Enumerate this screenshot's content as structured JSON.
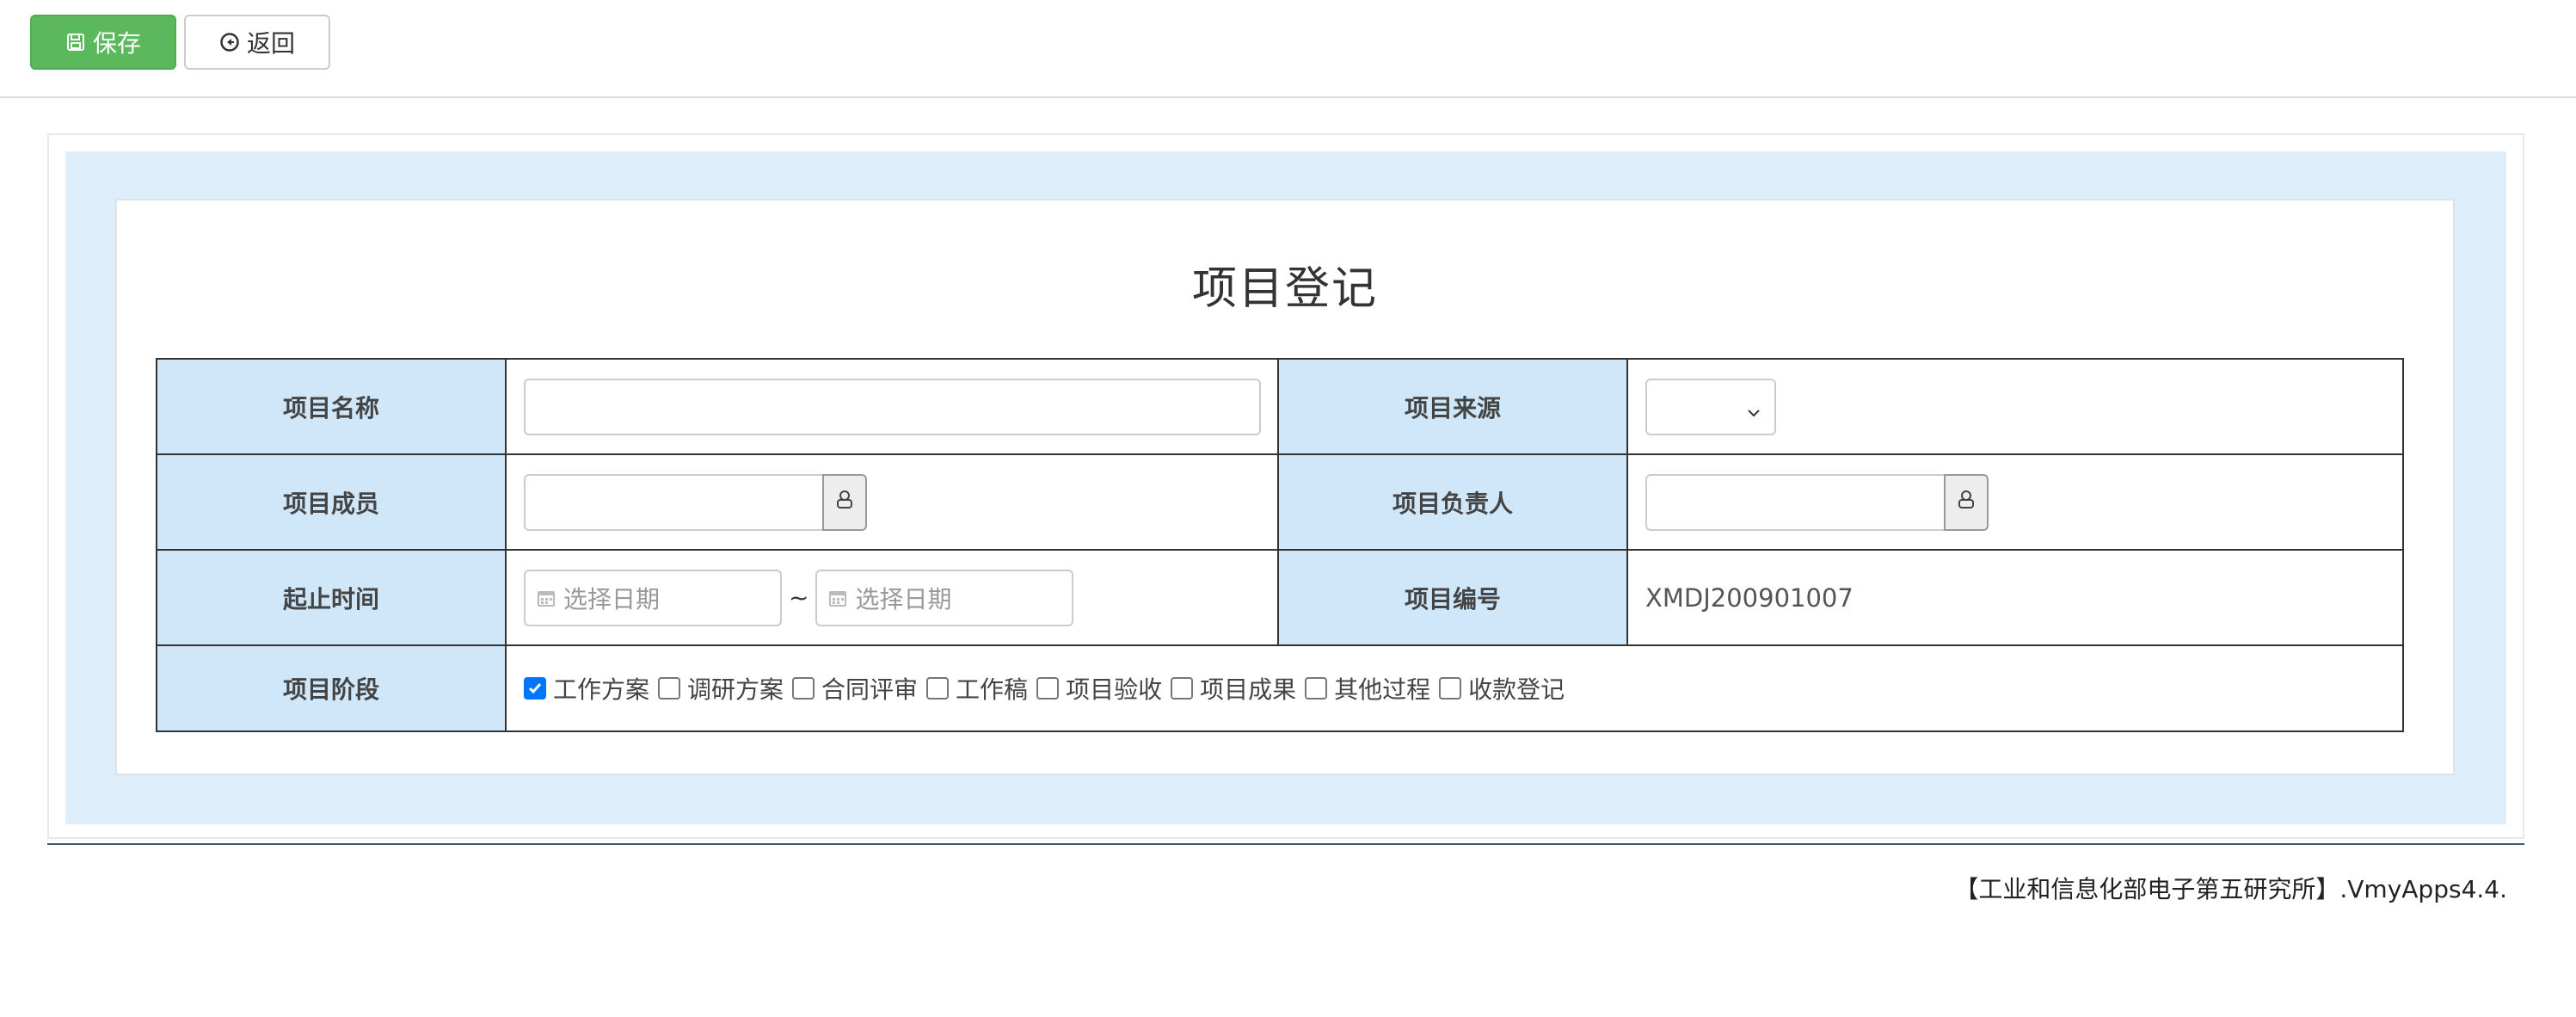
{
  "toolbar": {
    "save_label": "保存",
    "back_label": "返回"
  },
  "form": {
    "title": "项目登记",
    "labels": {
      "name": "项目名称",
      "source": "项目来源",
      "members": "项目成员",
      "leader": "项目负责人",
      "period": "起止时间",
      "code": "项目编号",
      "stage": "项目阶段"
    },
    "values": {
      "name": "",
      "source": "",
      "members": "",
      "leader": "",
      "code": "XMDJ200901007"
    },
    "date_placeholder_start": "选择日期",
    "date_placeholder_end": "选择日期",
    "date_separator": "~",
    "stages": [
      {
        "label": "工作方案",
        "checked": true
      },
      {
        "label": "调研方案",
        "checked": false
      },
      {
        "label": "合同评审",
        "checked": false
      },
      {
        "label": "工作稿",
        "checked": false
      },
      {
        "label": "项目验收",
        "checked": false
      },
      {
        "label": "项目成果",
        "checked": false
      },
      {
        "label": "其他过程",
        "checked": false
      },
      {
        "label": "收款登记",
        "checked": false
      }
    ]
  },
  "footer": {
    "text": "【工业和信息化部电子第五研究所】.VmyApps4.4."
  },
  "colors": {
    "save_button": "#5cb85c",
    "label_cell": "#cfe7f9",
    "panel_bg": "#ddedf9",
    "checkbox_checked": "#0075ff"
  }
}
